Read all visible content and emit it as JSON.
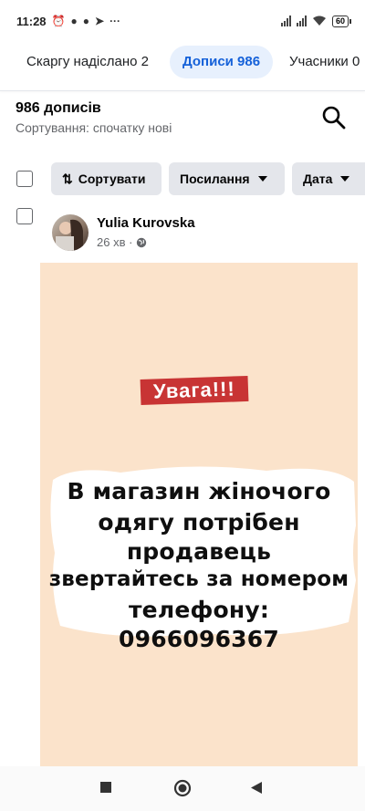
{
  "status": {
    "time": "11:28",
    "battery": "60"
  },
  "tabs": [
    {
      "label": "Скаргу надіслано 2"
    },
    {
      "label": "Дописи 986"
    },
    {
      "label": "Учасники 0"
    }
  ],
  "header": {
    "count": "986 дописів",
    "sort_label": "Сортування: спочатку нові"
  },
  "filters": {
    "sort": "Сортувати",
    "links": "Посилання",
    "date": "Дата"
  },
  "post": {
    "author": "Yulia Kurovska",
    "time": "26 хв ·",
    "image": {
      "badge": "Увага!!!",
      "lines": [
        "В магазин жіночого",
        "одягу потрібен",
        "продавець",
        "звертайтесь за номером",
        "телефону:",
        "0966096367"
      ]
    }
  },
  "colors": {
    "accent": "#1561d9",
    "tab_active_bg": "#e7f0fd",
    "chip_bg": "#e4e6eb",
    "post_bg": "#fbe3cb",
    "badge": "#c83434"
  }
}
